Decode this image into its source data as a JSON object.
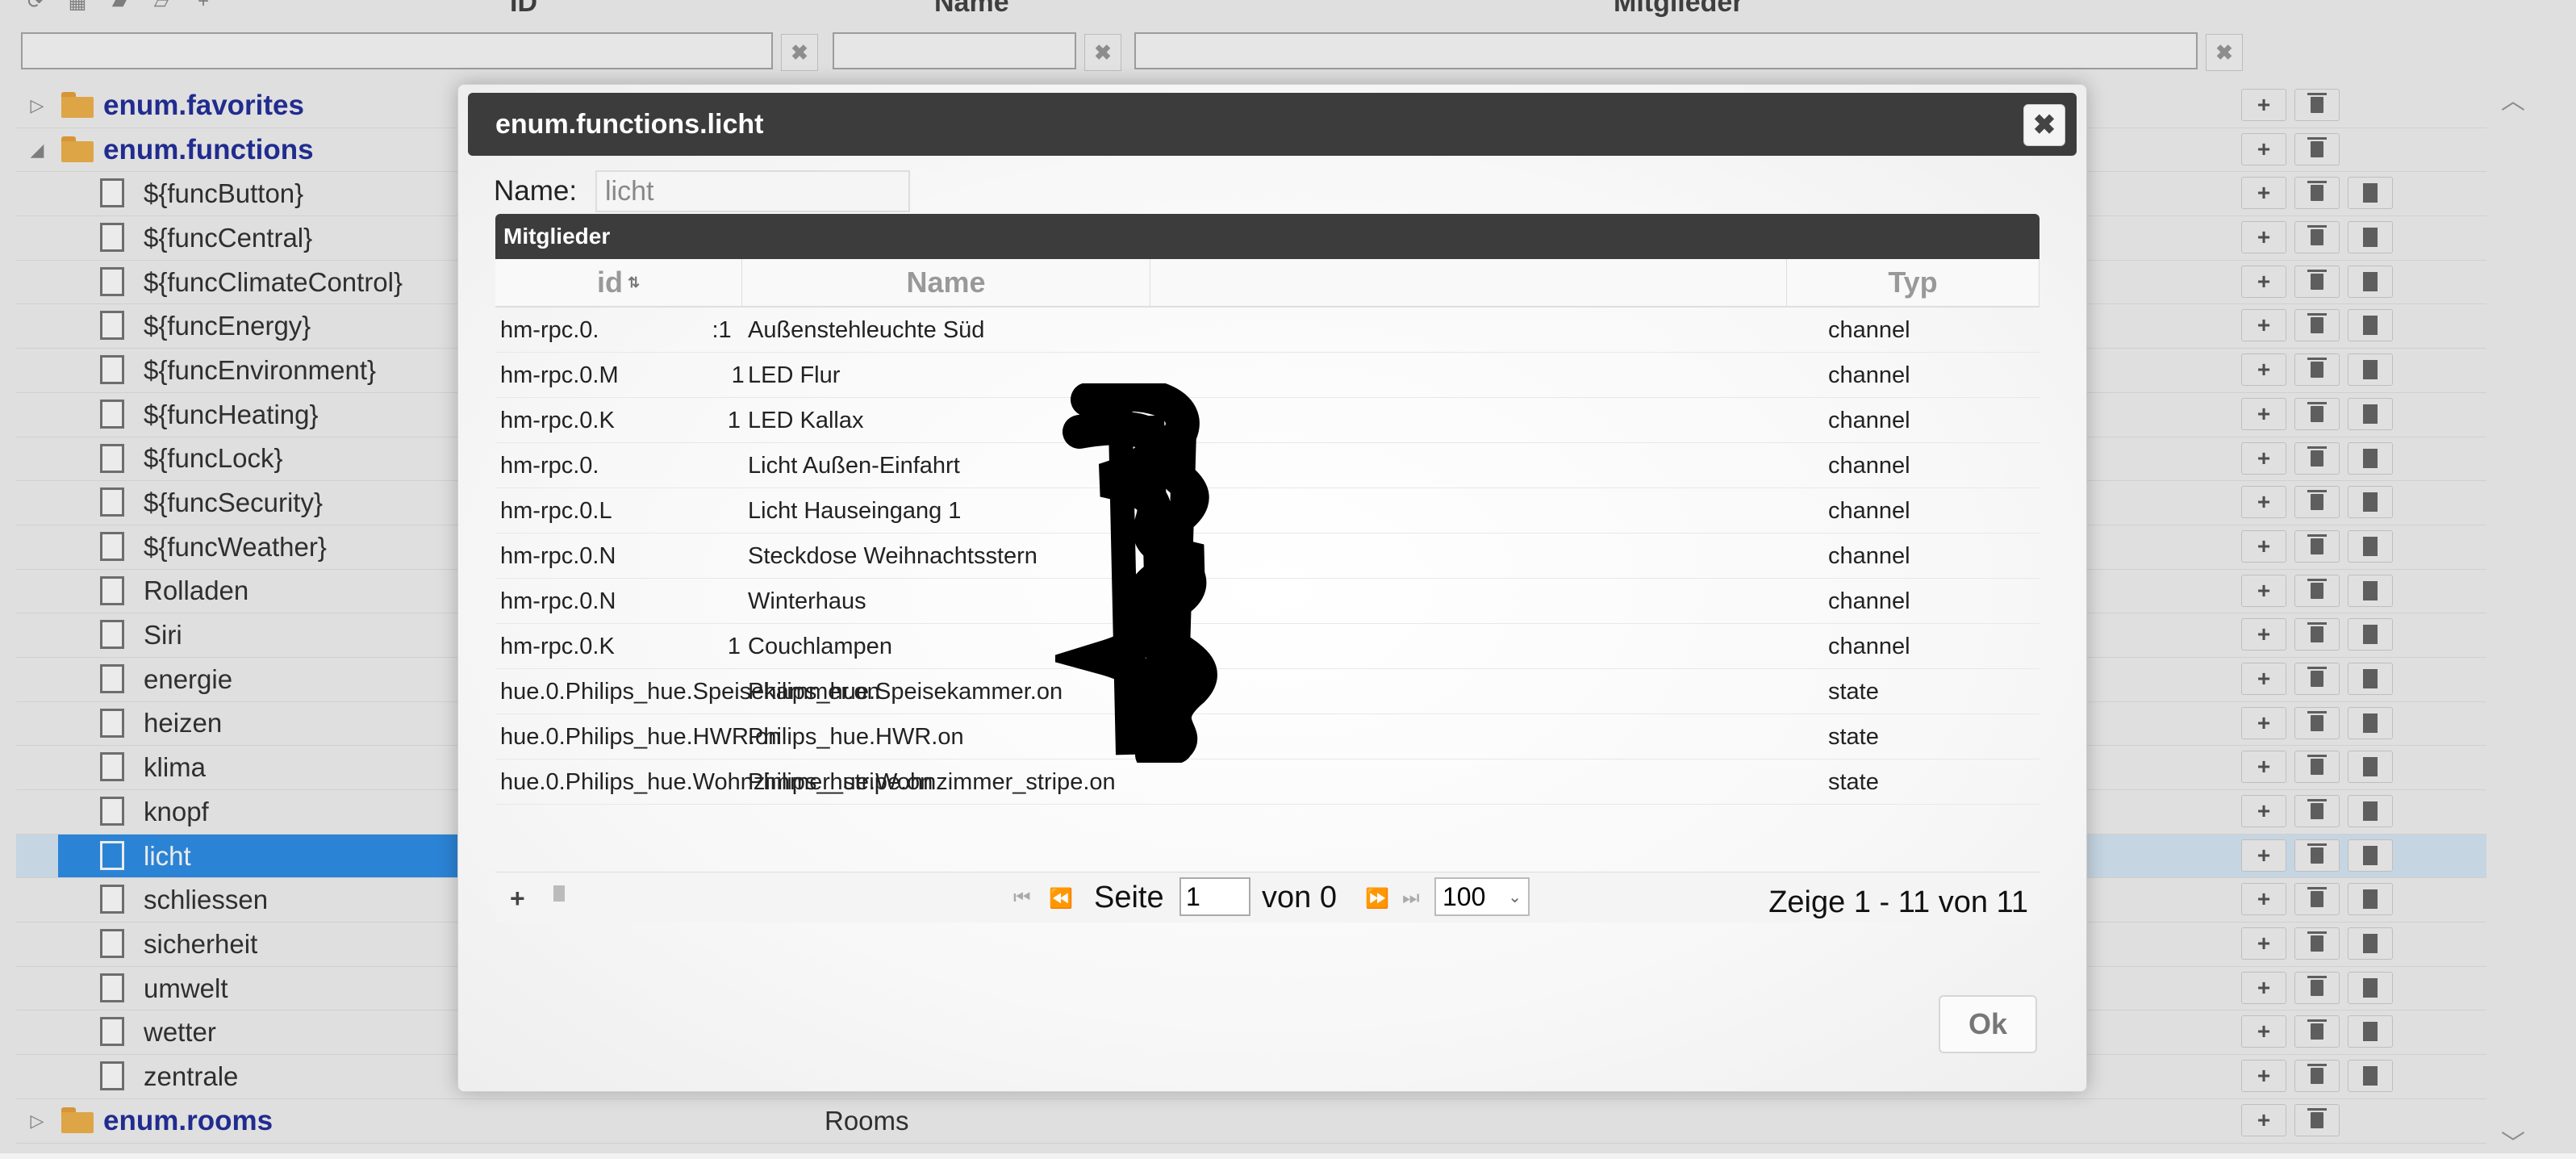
{
  "background": {
    "columns": {
      "id": "ID",
      "name": "Name",
      "members": "Mitglieder"
    },
    "tree": [
      {
        "label": "enum.favorites",
        "type": "folder",
        "expanded": false
      },
      {
        "label": "enum.functions",
        "type": "folder",
        "expanded": true
      },
      {
        "label": "${funcButton}",
        "type": "file"
      },
      {
        "label": "${funcCentral}",
        "type": "file"
      },
      {
        "label": "${funcClimateControl}",
        "type": "file"
      },
      {
        "label": "${funcEnergy}",
        "type": "file"
      },
      {
        "label": "${funcEnvironment}",
        "type": "file"
      },
      {
        "label": "${funcHeating}",
        "type": "file"
      },
      {
        "label": "${funcLock}",
        "type": "file"
      },
      {
        "label": "${funcSecurity}",
        "type": "file"
      },
      {
        "label": "${funcWeather}",
        "type": "file"
      },
      {
        "label": "Rolladen",
        "type": "file"
      },
      {
        "label": "Siri",
        "type": "file"
      },
      {
        "label": "energie",
        "type": "file"
      },
      {
        "label": "heizen",
        "type": "file"
      },
      {
        "label": "klima",
        "type": "file"
      },
      {
        "label": "knopf",
        "type": "file"
      },
      {
        "label": "licht",
        "type": "file",
        "selected": true
      },
      {
        "label": "schliessen",
        "type": "file"
      },
      {
        "label": "sicherheit",
        "type": "file"
      },
      {
        "label": "umwelt",
        "type": "file"
      },
      {
        "label": "wetter",
        "type": "file"
      },
      {
        "label": "zentrale",
        "type": "file"
      },
      {
        "label": "enum.rooms",
        "type": "folder",
        "expanded": false,
        "name": "Rooms"
      }
    ],
    "icons": {
      "add": "plus-icon",
      "delete": "trash-icon",
      "edit": "document-icon"
    }
  },
  "dialog": {
    "title": "enum.functions.licht",
    "close_icon": "✖",
    "name_label": "Name:",
    "name_value": "licht",
    "section_title": "Mitglieder",
    "headers": {
      "id": "id",
      "name": "Name",
      "type": "Typ"
    },
    "rows": [
      {
        "id_prefix": "hm-rpc.0.",
        "id_suffix": ":1",
        "name": "Außenstehleuchte Süd",
        "type": "channel"
      },
      {
        "id_prefix": "hm-rpc.0.M",
        "id_suffix": "1",
        "name": "LED Flur",
        "type": "channel"
      },
      {
        "id_prefix": "hm-rpc.0.K",
        "id_suffix": "1",
        "name": "LED Kallax",
        "type": "channel"
      },
      {
        "id_prefix": "hm-rpc.0.",
        "id_suffix": "",
        "name": "Licht Außen-Einfahrt",
        "type": "channel"
      },
      {
        "id_prefix": "hm-rpc.0.L",
        "id_suffix": "",
        "name": "Licht Hauseingang 1",
        "type": "channel"
      },
      {
        "id_prefix": "hm-rpc.0.N",
        "id_suffix": "",
        "name": "Steckdose Weihnachtsstern",
        "type": "channel"
      },
      {
        "id_prefix": "hm-rpc.0.N",
        "id_suffix": "",
        "name": "Winterhaus",
        "type": "channel"
      },
      {
        "id_prefix": "hm-rpc.0.K",
        "id_suffix": "1",
        "name": "Couchlampen",
        "type": "channel"
      },
      {
        "id_prefix": "hue.0.Philips_hue.Speisekammer.on",
        "id_suffix": "",
        "name": "Philips_hue.Speisekammer.on",
        "type": "state"
      },
      {
        "id_prefix": "hue.0.Philips_hue.HWR.on",
        "id_suffix": "",
        "name": "Philips_hue.HWR.on",
        "type": "state"
      },
      {
        "id_prefix": "hue.0.Philips_hue.Wohnzimmer_stripe.on",
        "id_suffix": "",
        "name": "Philips_hue.Wohnzimmer_stripe.on",
        "type": "state"
      }
    ],
    "pager": {
      "page_label": "Seite",
      "page_value": "1",
      "of_label": "von 0",
      "page_size": "100",
      "info": "Zeige 1 - 11 von 11"
    },
    "ok_label": "Ok"
  }
}
